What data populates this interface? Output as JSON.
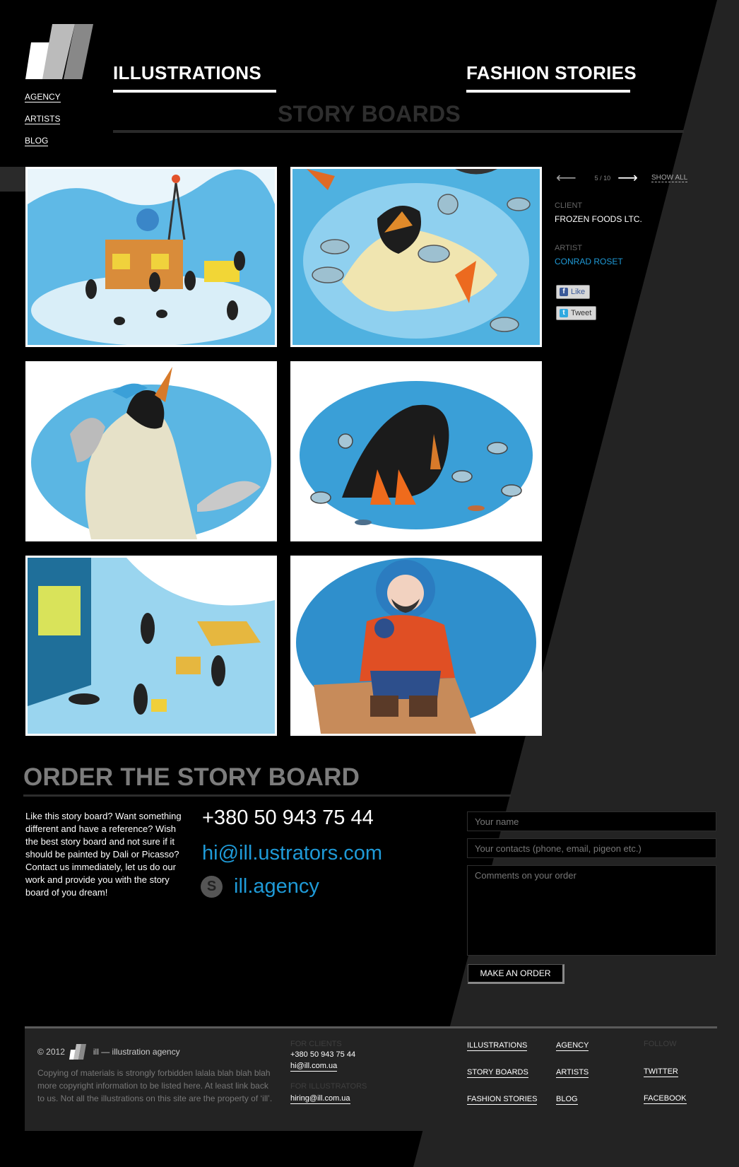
{
  "nav": {
    "agency": "AGENCY",
    "artists": "ARTISTS",
    "blog": "BLOG"
  },
  "categories": {
    "illustrations": "ILLUSTRATIONS",
    "fashion_stories": "FASHION STORIES",
    "story_boards": "STORY BOARDS"
  },
  "pager": {
    "prev": "⟵",
    "next": "⟶",
    "count": "5 / 10",
    "show_all": "SHOW ALL"
  },
  "details": {
    "client_label": "CLIENT",
    "client_value": "FROZEN FOODS LTC.",
    "artist_label": "ARTIST",
    "artist_value": "CONRAD ROSET",
    "like": "Like",
    "tweet": "Tweet"
  },
  "gallery": {
    "images": [
      {
        "name": "station-penguins"
      },
      {
        "name": "penguin-cans"
      },
      {
        "name": "penguin-fish-hat"
      },
      {
        "name": "penguin-bowing"
      },
      {
        "name": "penguins-boxes"
      },
      {
        "name": "eskimo-sitting"
      }
    ]
  },
  "order": {
    "title": "ORDER THE STORY BOARD",
    "text": "Like this story board? Want something different and have a reference? Wish the best story board and not sure if it should be painted by Dali or Picasso? Contact us immediately, let us do our work and provide you with the story board of you dream!",
    "phone": "+380 50 943 75 44",
    "email": "hi@ill.ustrators.com",
    "skype": "ill.agency",
    "name_placeholder": "Your name",
    "contacts_placeholder": "Your contacts (phone, email, pigeon etc.)",
    "comments_placeholder": "Comments on your order",
    "button": "MAKE AN ORDER"
  },
  "footer": {
    "copyright_year": "© 2012",
    "agency_name": "ill — illustration agency",
    "note": "Copying of materials is strongly forbidden lalala blah blah blah more copyright information to be listed here. At least link back to us. Not all the illustrations on this site are the property of ‘ill’.",
    "for_clients_label": "FOR CLIENTS",
    "clients_phone": "+380 50 943 75 44",
    "clients_email": "hi@ill.com.ua",
    "for_illustrators_label": "FOR ILLUSTRATORS",
    "illustrators_email": "hiring@ill.com.ua",
    "links": {
      "illustrations": "ILLUSTRATIONS",
      "story_boards": "STORY BOARDS",
      "fashion_stories": "FASHION STORIES",
      "agency": "AGENCY",
      "artists": "ARTISTS",
      "blog": "BLOG"
    },
    "follow_label": "FOLLOW",
    "twitter": "TWITTER",
    "facebook": "FACEBOOK"
  },
  "colors": {
    "accent_blue": "#1f9ad7",
    "background_black": "#000000",
    "background_dark": "#232323"
  }
}
